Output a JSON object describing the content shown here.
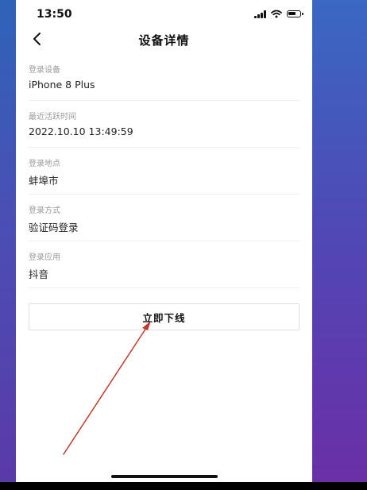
{
  "status_bar": {
    "time": "13:50"
  },
  "nav": {
    "title": "设备详情",
    "back_icon": "chevron-left-icon"
  },
  "details": [
    {
      "label": "登录设备",
      "value": "iPhone 8 Plus"
    },
    {
      "label": "最近活跃时间",
      "value": "2022.10.10 13:49:59"
    },
    {
      "label": "登录地点",
      "value": "蚌埠市"
    },
    {
      "label": "登录方式",
      "value": "验证码登录"
    },
    {
      "label": "登录应用",
      "value": "抖音"
    }
  ],
  "actions": {
    "logout_label": "立即下线"
  },
  "colors": {
    "annotation_arrow": "#c0392b",
    "background_gradient_top": "#2f63b8",
    "background_gradient_bottom": "#6a2fa7"
  }
}
